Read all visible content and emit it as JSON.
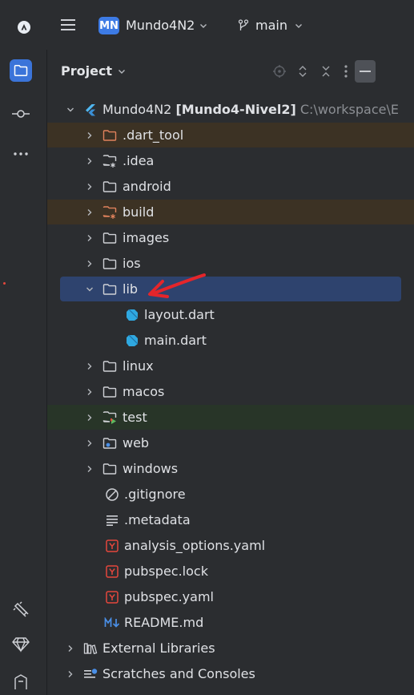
{
  "titlebar": {
    "project_badge": "MN",
    "project_name": "Mundo4N2",
    "branch": "main"
  },
  "panel": {
    "title": "Project"
  },
  "tree": {
    "root": {
      "name": "Mundo4N2",
      "module": "[Mundo4-Nivel2]",
      "path": "C:\\workspace\\E"
    },
    "items": [
      {
        "label": ".dart_tool",
        "type": "folder",
        "state": "excluded"
      },
      {
        "label": ".idea",
        "type": "folder-config"
      },
      {
        "label": "android",
        "type": "folder"
      },
      {
        "label": "build",
        "type": "folder-config",
        "state": "excluded"
      },
      {
        "label": "images",
        "type": "folder"
      },
      {
        "label": "ios",
        "type": "folder"
      },
      {
        "label": "lib",
        "type": "folder",
        "state": "selected",
        "expanded": true
      },
      {
        "label": "layout.dart",
        "type": "dart-file"
      },
      {
        "label": "main.dart",
        "type": "dart-file"
      },
      {
        "label": "linux",
        "type": "folder"
      },
      {
        "label": "macos",
        "type": "folder"
      },
      {
        "label": "test",
        "type": "folder-test",
        "state": "test"
      },
      {
        "label": "web",
        "type": "folder-web"
      },
      {
        "label": "windows",
        "type": "folder"
      },
      {
        "label": ".gitignore",
        "type": "ignore-file"
      },
      {
        "label": ".metadata",
        "type": "text-file"
      },
      {
        "label": "analysis_options.yaml",
        "type": "yaml-file"
      },
      {
        "label": "pubspec.lock",
        "type": "yaml-file"
      },
      {
        "label": "pubspec.yaml",
        "type": "yaml-file"
      },
      {
        "label": "README.md",
        "type": "markdown-file"
      },
      {
        "label": "External Libraries",
        "type": "libraries"
      },
      {
        "label": "Scratches and Consoles",
        "type": "scratches"
      }
    ]
  },
  "colors": {
    "background": "#2b2d30",
    "selection": "#2e436e",
    "excluded": "#3c3224",
    "test": "#283528",
    "accent": "#3b74d9",
    "annotation_arrow": "#e5252a"
  }
}
